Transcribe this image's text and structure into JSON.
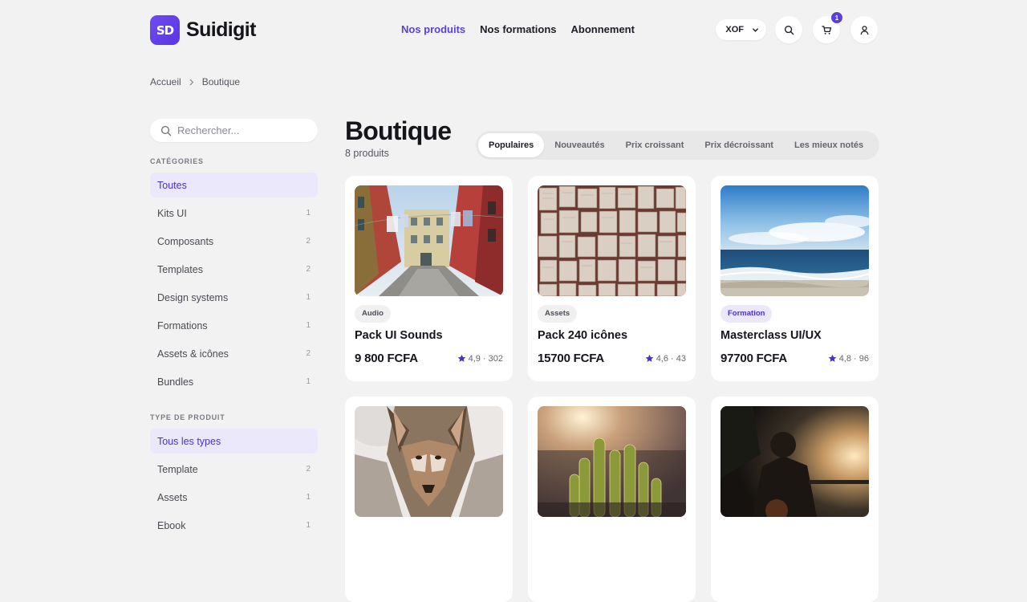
{
  "brand": {
    "logo_mark": "SD",
    "name": "Suidigit",
    "accent": "#5b3fd9"
  },
  "nav": {
    "items": [
      {
        "label": "Nos produits",
        "active": true
      },
      {
        "label": "Nos formations",
        "active": false
      },
      {
        "label": "Abonnement",
        "active": false
      }
    ]
  },
  "header": {
    "currency": "XOF",
    "cart_count": "1"
  },
  "breadcrumb": [
    "Accueil",
    "Boutique"
  ],
  "sidebar": {
    "search_placeholder": "Rechercher...",
    "categories_title": "CATÉGORIES",
    "categories": [
      {
        "label": "Toutes",
        "count": "",
        "active": true
      },
      {
        "label": "Kits UI",
        "count": "1",
        "active": false
      },
      {
        "label": "Composants",
        "count": "2",
        "active": false
      },
      {
        "label": "Templates",
        "count": "2",
        "active": false
      },
      {
        "label": "Design systems",
        "count": "1",
        "active": false
      },
      {
        "label": "Formations",
        "count": "1",
        "active": false
      },
      {
        "label": "Assets & icônes",
        "count": "2",
        "active": false
      },
      {
        "label": "Bundles",
        "count": "1",
        "active": false
      }
    ],
    "types_title": "TYPE DE PRODUIT",
    "types": [
      {
        "label": "Tous les types",
        "count": "",
        "active": true
      },
      {
        "label": "Template",
        "count": "2",
        "active": false
      },
      {
        "label": "Assets",
        "count": "1",
        "active": false
      },
      {
        "label": "Ebook",
        "count": "1",
        "active": false
      }
    ]
  },
  "main": {
    "title": "Boutique",
    "count": "8 produits",
    "sort_tabs": [
      {
        "label": "Populaires",
        "active": true
      },
      {
        "label": "Nouveautés",
        "active": false
      },
      {
        "label": "Prix croissant",
        "active": false
      },
      {
        "label": "Prix décroissant",
        "active": false
      },
      {
        "label": "Les mieux notés",
        "active": false
      }
    ],
    "products": [
      {
        "tag": "Audio",
        "title": "Pack UI Sounds",
        "price": "9 800 FCFA",
        "rating": "4,9 · 302",
        "image": "colorful-street-photo"
      },
      {
        "tag": "Assets",
        "title": "Pack 240 icônes",
        "price": "15700 FCFA",
        "rating": "4,6 · 43",
        "image": "book-pages-photo"
      },
      {
        "tag": "Formation",
        "title": "Masterclass UI/UX",
        "price": "97700 FCFA",
        "rating": "4,8 · 96",
        "image": "ocean-beach-photo"
      },
      {
        "image": "coyote-photo"
      },
      {
        "image": "cactus-sunset-photo"
      },
      {
        "image": "person-silhouette-photo"
      }
    ]
  }
}
